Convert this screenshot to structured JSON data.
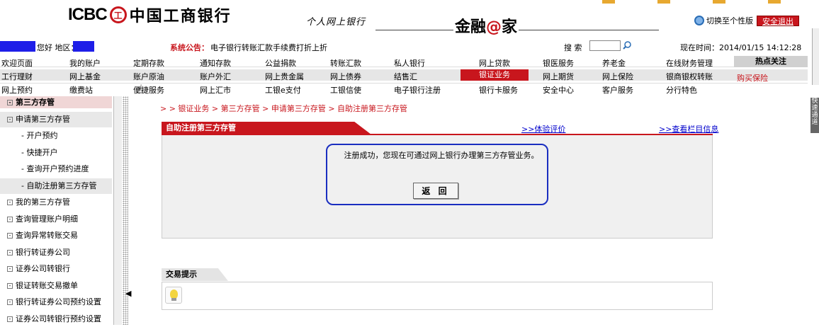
{
  "header": {
    "logo_en": "ICBC",
    "logo_mark": "工",
    "logo_cn": "中国工商银行",
    "personal": "个人网上银行",
    "brand_a": "金融",
    "brand_at": "@",
    "brand_b": "家",
    "switch_label": "切换至个性版",
    "logout_label": "安全退出"
  },
  "infobar": {
    "greeting": "您好 地区：",
    "notice_label": "系统公告：",
    "notice_text": "电子银行转账汇款手续费打折上折",
    "search_label": "搜 索",
    "time_text": "现在时间：2014/01/15 14:12:28"
  },
  "nav": {
    "row1": [
      "欢迎页面",
      "我的账户",
      "定期存款",
      "通知存款",
      "公益捐款",
      "转账汇款",
      "私人银行",
      "网上贷款",
      "银医服务",
      "养老金",
      "在线财务管理"
    ],
    "row2": [
      "工行理财",
      "网上基金",
      "账户原油",
      "账户外汇",
      "网上贵金属",
      "网上债券",
      "结售汇",
      "银证业务",
      "网上期货",
      "网上保险",
      "银商银权转账"
    ],
    "row3": [
      "网上预约",
      "缴费站",
      "便捷服务",
      "网上汇市",
      "工银e支付",
      "工银信使",
      "电子银行注册",
      "银行卡服务",
      "安全中心",
      "客户服务",
      "分行特色"
    ],
    "hot_title": "热点关注",
    "hot_link": "购买保险"
  },
  "sidebar": {
    "items": [
      "第三方存管",
      "申请第三方存管",
      "- 开户预约",
      "- 快捷开户",
      "- 查询开户预约进度",
      "- 自助注册第三方存管",
      "我的第三方存管",
      "查询管理账户明细",
      "查询异常转账交易",
      "银行转证券公司",
      "证券公司转银行",
      "银证转账交易撤单",
      "银行转证券公司预约设置",
      "证券公司转银行预约设置"
    ]
  },
  "main": {
    "breadcrumb": "> > 银证业务 > 第三方存管 > 申请第三方存管 > 自助注册第三方存管",
    "panel_title": "自助注册第三方存管",
    "link_rate": ">>体验评价",
    "link_info": ">>查看栏目信息",
    "message": "注册成功，您现在可通过网上银行办理第三方存管业务。",
    "back_label": "返 回",
    "tip_title": "交易提示"
  },
  "side_tab": "快速通道",
  "colors": {
    "accent": "#c8161d",
    "link": "#0000cc",
    "highlight": "#1a2ec0"
  }
}
